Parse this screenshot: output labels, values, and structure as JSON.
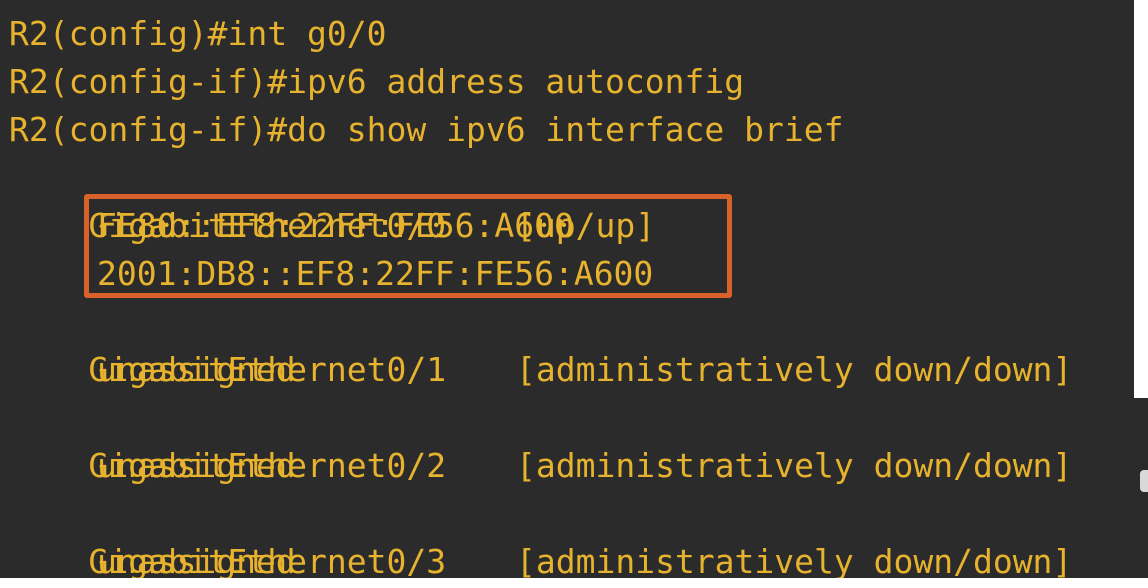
{
  "terminal": {
    "lines": [
      {
        "text": "R2(config)#int g0/0"
      },
      {
        "text": "R2(config-if)#ipv6 address autoconfig"
      },
      {
        "text": "R2(config-if)#do show ipv6 interface brief"
      },
      {
        "text": "GigabitEthernet0/0",
        "status": "[up/up]"
      },
      {
        "text": "FE80::EF8:22FF:FE56:A600"
      },
      {
        "text": "2001:DB8::EF8:22FF:FE56:A600"
      },
      {
        "text": "GigabitEthernet0/1",
        "status": "[administratively down/down]"
      },
      {
        "text": "unassigned"
      },
      {
        "text": "GigabitEthernet0/2",
        "status": "[administratively down/down]"
      },
      {
        "text": "unassigned"
      },
      {
        "text": "GigabitEthernet0/3",
        "status": "[administratively down/down]"
      },
      {
        "text": "unassigned"
      }
    ]
  },
  "colors": {
    "background": "#2b2b2b",
    "text": "#e7b32f",
    "highlight": "#d9622b"
  }
}
